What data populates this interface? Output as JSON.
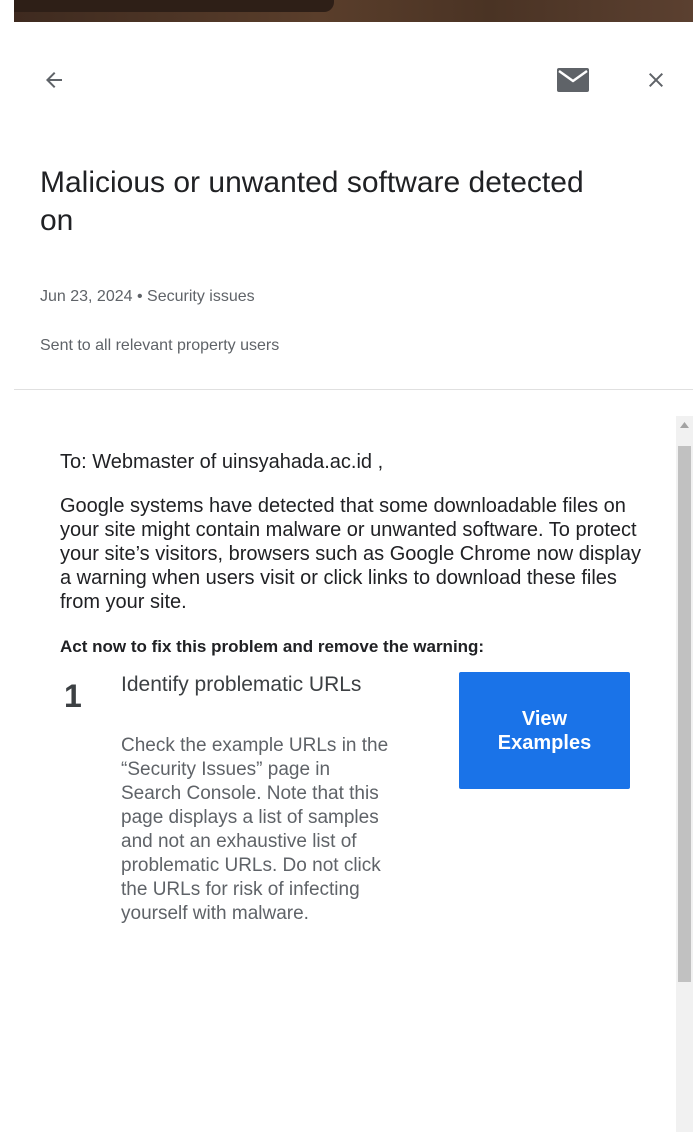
{
  "header": {
    "back_icon": "arrow-back-icon",
    "mail_icon": "mail-icon",
    "close_icon": "close-icon"
  },
  "message": {
    "title": "Malicious or unwanted software detected on",
    "meta": "Jun 23, 2024 • Security issues",
    "sent_to": "Sent to all relevant property users"
  },
  "email": {
    "greeting": "To: Webmaster of uinsyahada.ac.id ,",
    "intro": "Google systems have detected that some downloadable files on your site might contain malware or unwanted software. To protect your site’s visitors, browsers such as Google Chrome now display a warning when users visit or click links to download these files from your site.",
    "act_now": "Act now to fix this problem and remove the warning:",
    "steps": [
      {
        "number": "1",
        "title": "Identify problematic URLs",
        "description": "Check the example URLs in the “Security Issues” page in Search Console. Note that this page displays a list of samples and not an exhaustive list of problematic URLs. Do not click the URLs for risk of infecting yourself with malware.",
        "button_label": "View Examples"
      }
    ]
  },
  "colors": {
    "primary_button": "#1a73e8",
    "title_text": "#202124",
    "secondary_text": "#5f6368",
    "top_strip": "#4a3324"
  }
}
